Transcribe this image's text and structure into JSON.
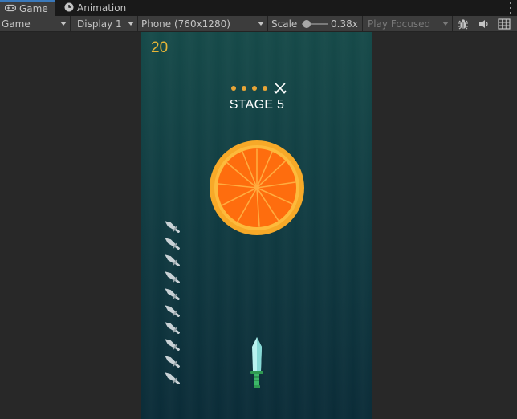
{
  "tabs": [
    {
      "label": "Game",
      "icon": "gamepad-icon",
      "active": true
    },
    {
      "label": "Animation",
      "icon": "animation-clock-icon",
      "active": false
    }
  ],
  "toolbar": {
    "game_mode": "Game",
    "display": "Display 1",
    "resolution": "Phone (760x1280)",
    "scale_label": "Scale",
    "scale_value": "0.38x",
    "play_mode": "Play Focused"
  },
  "game": {
    "score": "20",
    "stage_label": "STAGE 5",
    "stage_progress_dots": 4,
    "boss_icon": "crossed-swords-icon",
    "knives_remaining": 10,
    "colors": {
      "score": "#e8b637",
      "dot": "#e8a537",
      "orange_rind": "#f7a928",
      "orange_flesh": "#fe6d0e",
      "knife_blade": "#b9f2f0",
      "knife_handle": "#2f9a52"
    }
  }
}
